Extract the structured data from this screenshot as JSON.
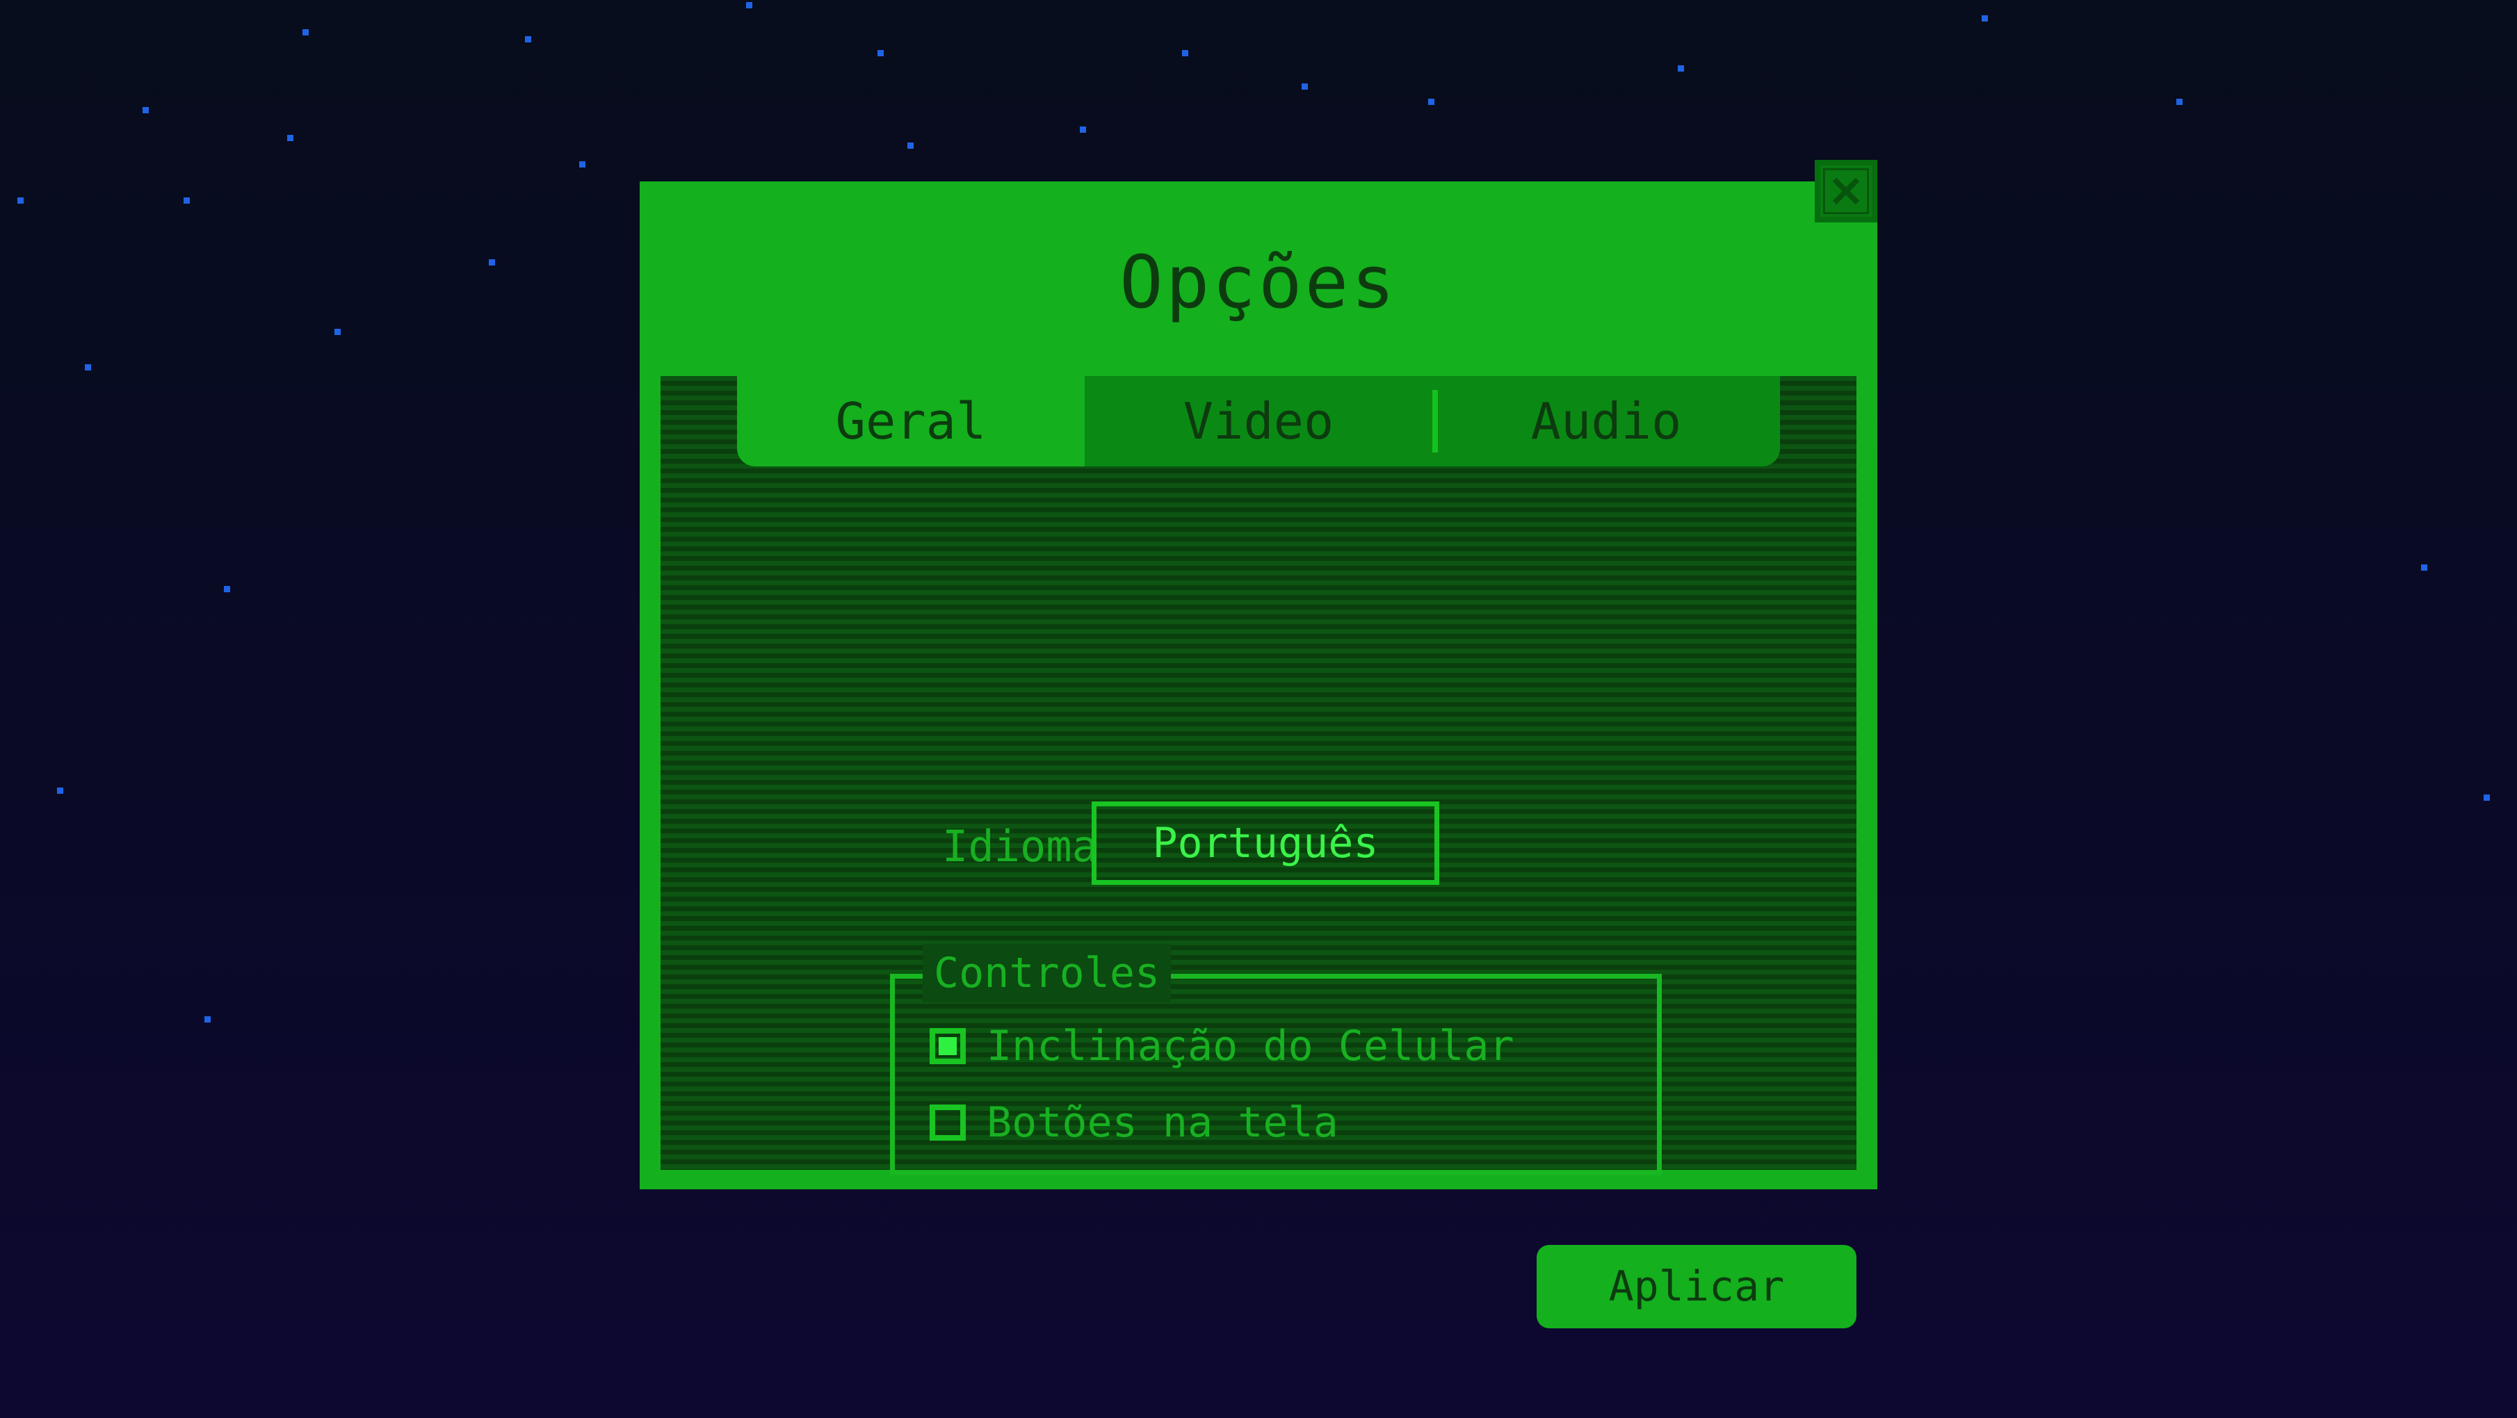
{
  "dialog": {
    "title": "Opções",
    "close_icon": "close-icon"
  },
  "tabs": [
    {
      "label": "Geral",
      "active": true
    },
    {
      "label": "Video",
      "active": false
    },
    {
      "label": "Audio",
      "active": false
    }
  ],
  "general": {
    "language_label": "Idioma",
    "language_value": "Português",
    "controls_legend": "Controles",
    "options": [
      {
        "label": "Inclinação do Celular",
        "checked": true
      },
      {
        "label": "Botões na tela",
        "checked": false
      }
    ]
  },
  "footer": {
    "apply_label": "Aplicar"
  },
  "colors": {
    "accent": "#14b01e",
    "panel_dark": "#0a3f0d",
    "text_dark": "#0d3b0f",
    "highlight": "#3cf24a",
    "background": "#0a0a27",
    "star": "#1f64e6"
  }
}
